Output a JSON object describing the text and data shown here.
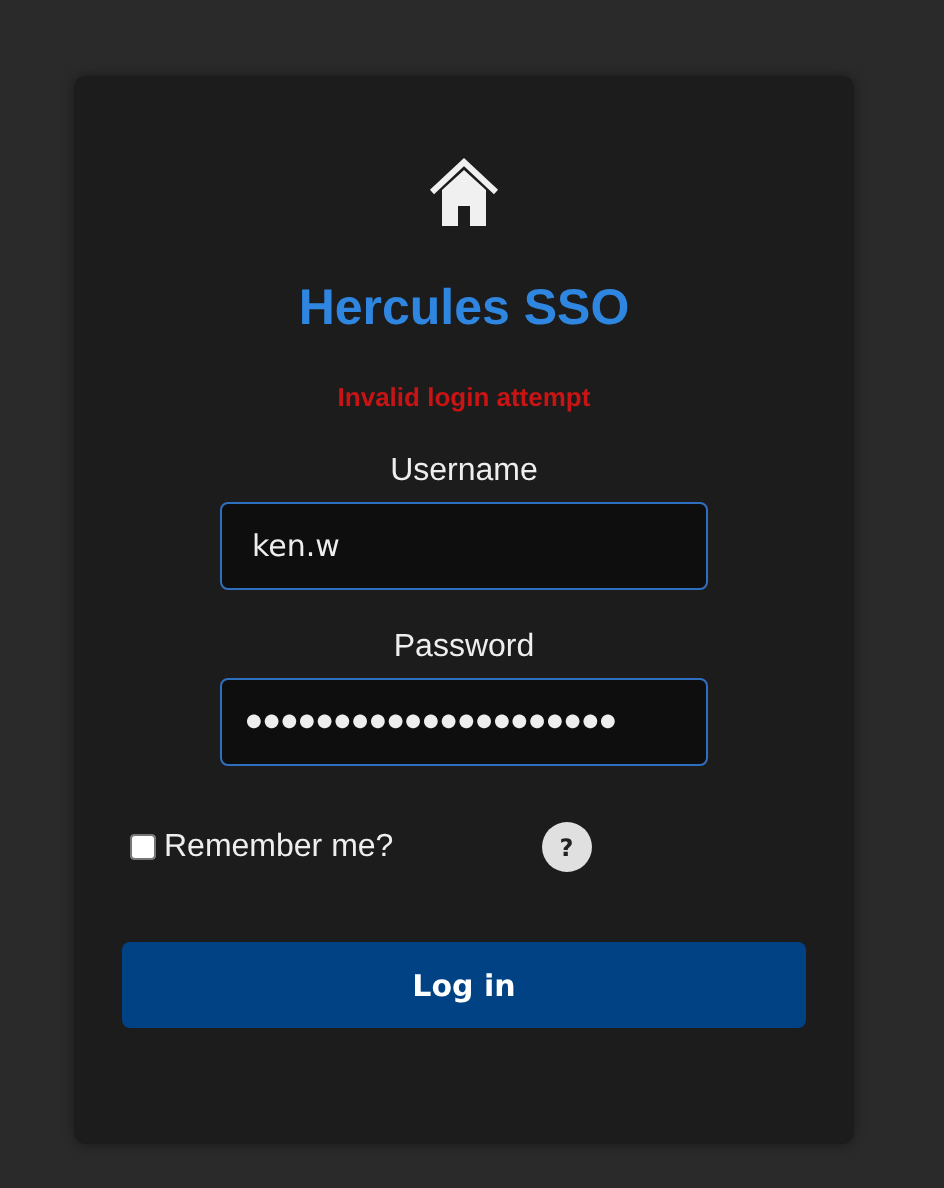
{
  "title": "Hercules SSO",
  "error": "Invalid login attempt",
  "fields": [
    {
      "label": "Username",
      "value": "ken.w"
    },
    {
      "label": "Password",
      "value": "●●●●●●●●●●●●●●●●●●●●●"
    }
  ],
  "remember": {
    "label": "Remember me?",
    "checked": false
  },
  "help": "?",
  "button": "Log in"
}
